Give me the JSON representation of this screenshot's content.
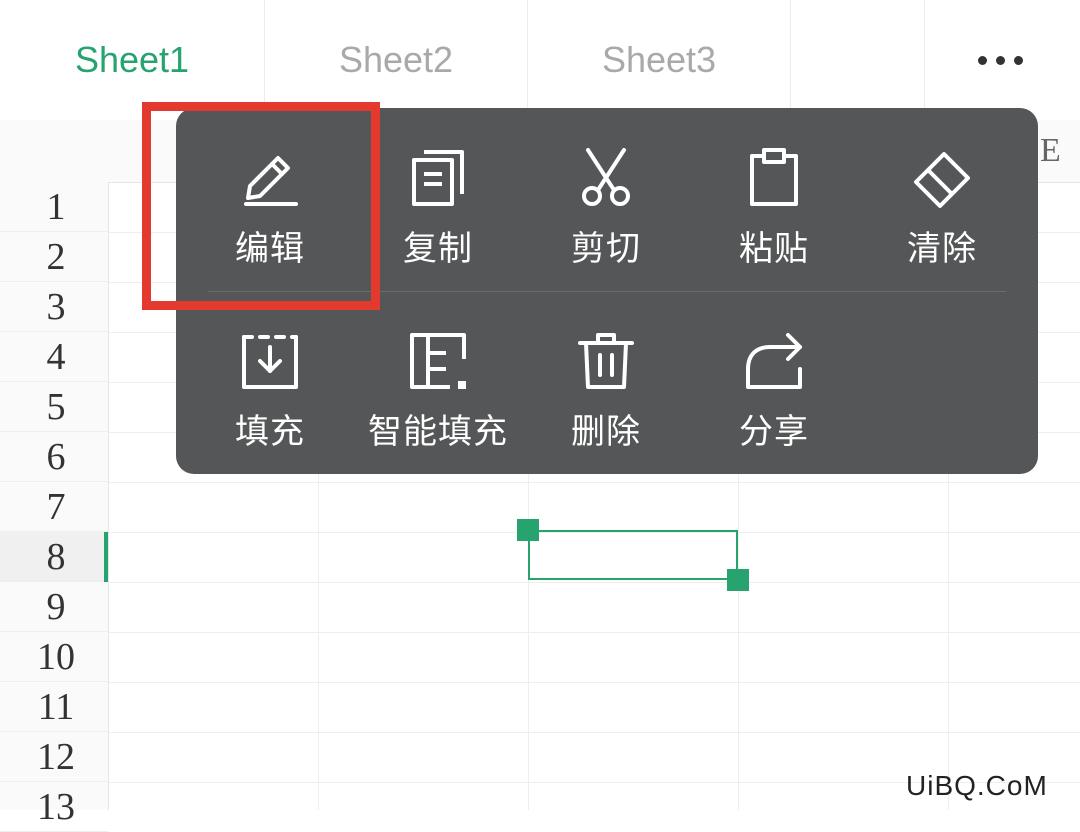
{
  "tabs": [
    {
      "label": "Sheet1",
      "active": true
    },
    {
      "label": "Sheet2",
      "active": false
    },
    {
      "label": "Sheet3",
      "active": false
    }
  ],
  "more_icon": "more-horizontal-icon",
  "columns": [
    "E"
  ],
  "rows": [
    "1",
    "2",
    "3",
    "4",
    "5",
    "6",
    "7",
    "8",
    "9",
    "10",
    "11",
    "12",
    "13"
  ],
  "active_row": "8",
  "context_menu": {
    "row1": [
      {
        "label": "编辑",
        "icon": "edit-pencil-icon"
      },
      {
        "label": "复制",
        "icon": "copy-icon"
      },
      {
        "label": "剪切",
        "icon": "scissors-icon"
      },
      {
        "label": "粘贴",
        "icon": "clipboard-icon"
      },
      {
        "label": "清除",
        "icon": "eraser-icon"
      }
    ],
    "row2": [
      {
        "label": "填充",
        "icon": "fill-down-icon"
      },
      {
        "label": "智能填充",
        "icon": "smart-fill-icon"
      },
      {
        "label": "删除",
        "icon": "trash-icon"
      },
      {
        "label": "分享",
        "icon": "share-icon"
      }
    ]
  },
  "colors": {
    "accent": "#26a36f",
    "menu_bg": "#555657",
    "highlight": "#e3392f"
  },
  "watermark": "UiBQ.CoM"
}
